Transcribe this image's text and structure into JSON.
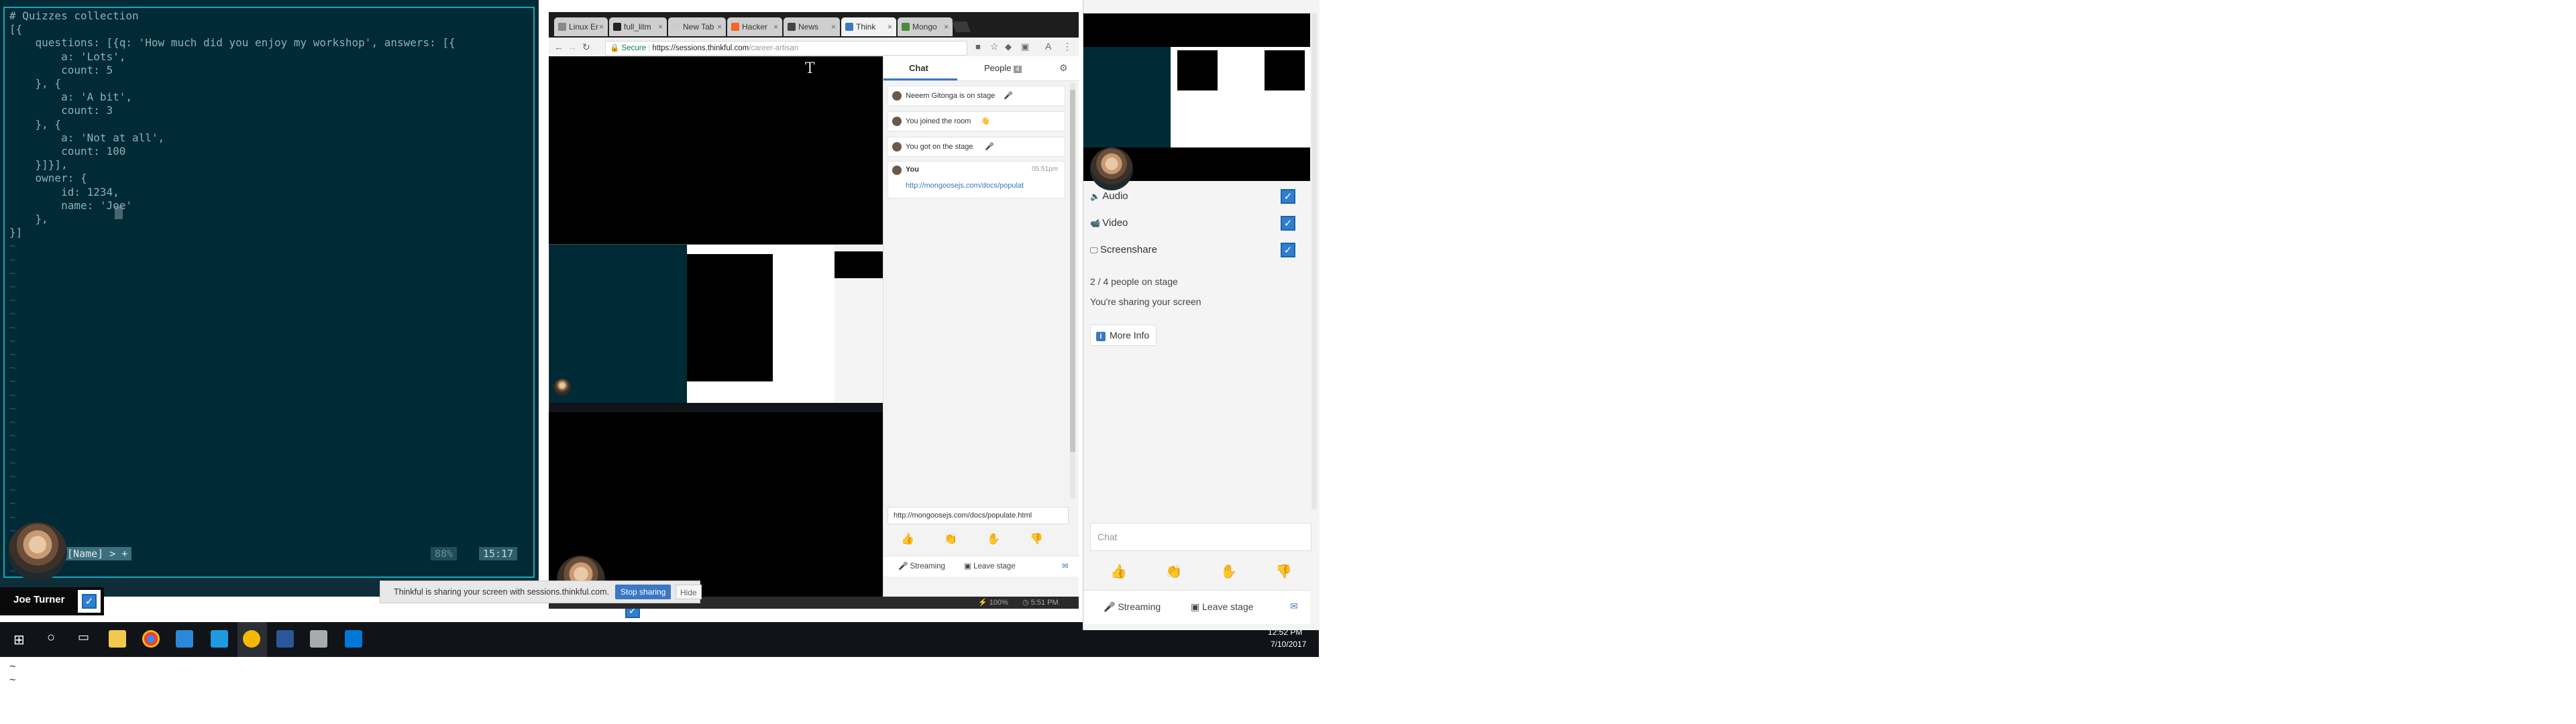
{
  "editor": {
    "lines": [
      "# Quizzes collection",
      "[{",
      "    questions: [{q: 'How much did you enjoy my workshop', answers: [{",
      "        a: 'Lots',",
      "        count: 5",
      "    }, {",
      "        a: 'A bit',",
      "        count: 3",
      "    }, {",
      "        a: 'Not at all',",
      "        count: 100",
      "    }]}],",
      "    owner: {",
      "        id: 1234,",
      "        name: 'Joe'",
      "    },",
      "}]"
    ],
    "tilde_count": 33,
    "status": {
      "mode": "[Name] > +",
      "percent": "88%",
      "position": "15:17"
    },
    "colors": {
      "background": "#002a36",
      "frame": "#1aa7b5",
      "text": "#8fb0b5"
    }
  },
  "self_user": {
    "name": "Joe Turner",
    "check": "✓"
  },
  "notification": {
    "text": "Thinkful is sharing your screen with sessions.thinkful.com.",
    "stop_label": "Stop sharing",
    "hide_label": "Hide"
  },
  "browser": {
    "tabs": [
      {
        "label": "Linux Er",
        "color": "#888"
      },
      {
        "label": "full_litm",
        "color": "#222"
      },
      {
        "label": "New Tab",
        "color": "#ccc"
      },
      {
        "label": "Hacker",
        "color": "#f26522"
      },
      {
        "label": "News",
        "color": "#444"
      },
      {
        "label": "Think",
        "color": "#3b78c4"
      },
      {
        "label": "Mongo",
        "color": "#4a8a3a"
      }
    ],
    "url": {
      "secure": "Secure",
      "host": "https://sessions.thinkful.com",
      "path": "/career-artisan"
    },
    "remote_user": {
      "name": "Neeem Gitonga",
      "check": "✓"
    },
    "side_panel": {
      "tabs": {
        "chat": "Chat",
        "people": "People",
        "people_count": "4",
        "settings_icon": "gear-icon"
      },
      "messages": [
        {
          "text": "Neeem Gitonga is on stage",
          "emoji": "🎤"
        },
        {
          "text": "You joined the room",
          "emoji": "👋"
        },
        {
          "text": "You got on the stage",
          "emoji": "🎤"
        }
      ],
      "user_message": {
        "author": "You",
        "time": "05:51pm",
        "link": "http://mongoosejs.com/docs/populat"
      },
      "input_value": "http://mongoosejs.com/docs/populate.html",
      "reactions": [
        "👍",
        "👏",
        "✋",
        "👎"
      ],
      "streaming_label": "Streaming",
      "leave_label": "Leave stage"
    },
    "status_bar": {
      "battery": "100%",
      "time": "5:51 PM"
    }
  },
  "taskbar": {
    "time": "12:52 PM",
    "date": "7/10/2017"
  },
  "panel": {
    "options": [
      {
        "label": "Audio",
        "icon": "speaker-icon",
        "checked": true
      },
      {
        "label": "Video",
        "icon": "camera-icon",
        "checked": true
      },
      {
        "label": "Screenshare",
        "icon": "monitor-icon",
        "checked": true
      }
    ],
    "people_on_stage": "2 / 4 people on stage",
    "sharing_note": "You're sharing your screen",
    "more_info_label": "More Info",
    "chat_placeholder": "Chat",
    "reactions": [
      "👍",
      "👏",
      "✋",
      "👎"
    ],
    "streaming_label": "Streaming",
    "leave_label": "Leave stage"
  }
}
